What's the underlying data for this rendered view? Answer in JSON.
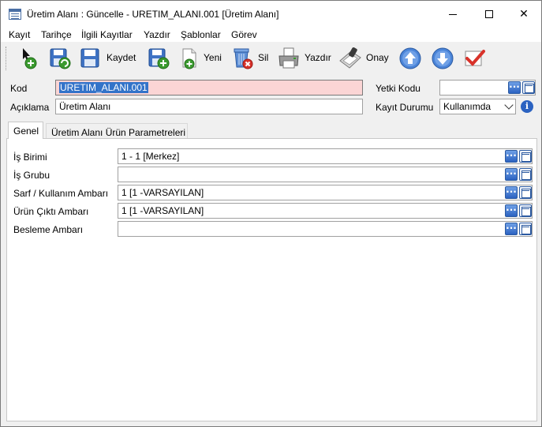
{
  "window": {
    "title": "Üretim Alanı : Güncelle - URETIM_ALANI.001 [Üretim Alanı]",
    "minimize": "",
    "close": "✕"
  },
  "menu": [
    "Kayıt",
    "Tarihçe",
    "İlgili Kayıtlar",
    "Yazdır",
    "Şablonlar",
    "Görev"
  ],
  "toolbar": {
    "kaydet": "Kaydet",
    "yeni": "Yeni",
    "sil": "Sil",
    "yazdir": "Yazdır",
    "onay": "Onay",
    "icons": [
      "new-record-icon",
      "save-refresh-icon",
      "save-icon",
      "save-new-icon",
      "new-document-icon",
      "delete-icon",
      "printer-icon",
      "approve-icon",
      "arrow-up-icon",
      "arrow-down-icon",
      "check-icon"
    ]
  },
  "header": {
    "kod_label": "Kod",
    "kod_value": "URETIM_ALANI.001",
    "aciklama_label": "Açıklama",
    "aciklama_value": "Üretim Alanı",
    "yetki_label": "Yetki Kodu",
    "yetki_value": "",
    "kayit_durumu_label": "Kayıt Durumu",
    "kayit_durumu_value": "Kullanımda"
  },
  "tabs": [
    {
      "label": "Genel",
      "active": true
    },
    {
      "label": "Üretim Alanı Ürün Parametreleri",
      "active": false
    }
  ],
  "general": {
    "rows": [
      {
        "label": "İş Birimi",
        "value": "1 - 1 [Merkez]"
      },
      {
        "label": "İş Grubu",
        "value": ""
      },
      {
        "label": "Sarf / Kullanım Ambarı",
        "value": "1 [1 -VARSAYILAN]"
      },
      {
        "label": "Ürün Çıktı Ambarı",
        "value": "1 [1 -VARSAYILAN]"
      },
      {
        "label": "Besleme Ambarı",
        "value": ""
      }
    ]
  },
  "colors": {
    "kod_bg": "#fbd5d5",
    "selection": "#3373c9",
    "lookup_blue": "#2b62c1"
  }
}
